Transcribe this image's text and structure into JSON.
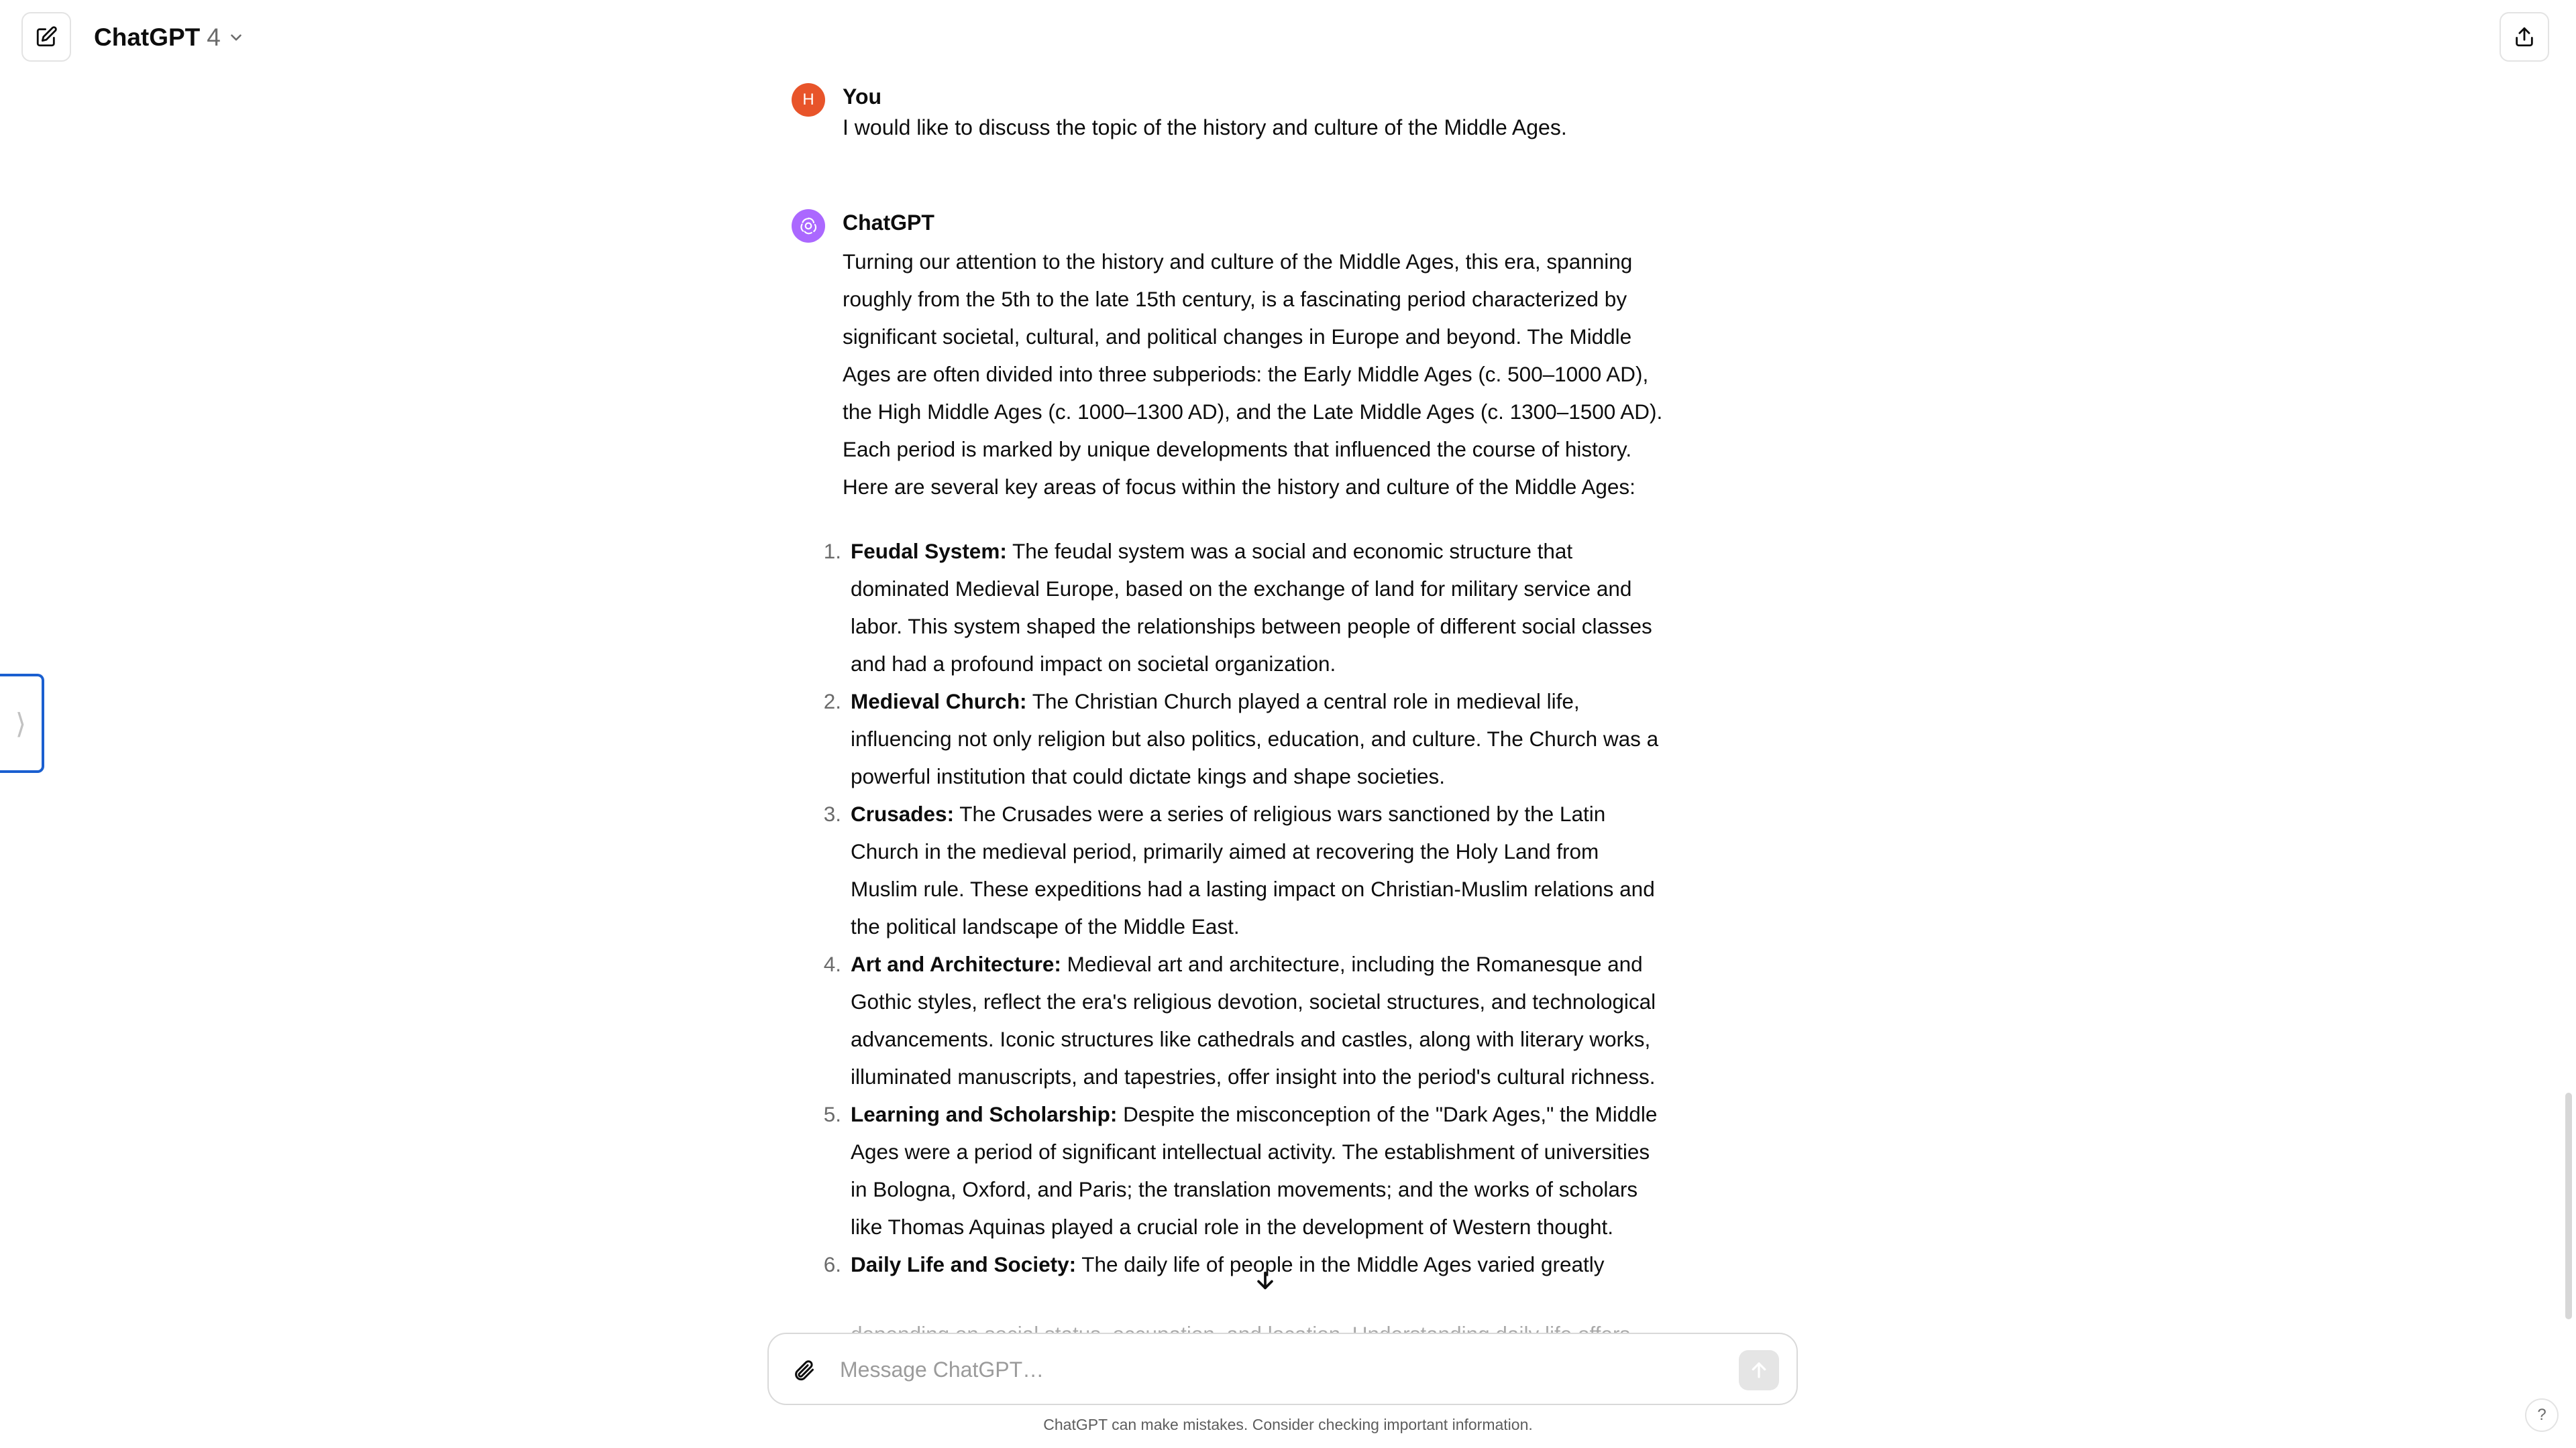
{
  "header": {
    "model_name": "ChatGPT",
    "model_version": "4"
  },
  "icons": {
    "new_chat": "edit-icon",
    "share": "share-icon",
    "chevron": "chevron-down-icon",
    "sidebar": "chevron-right-icon",
    "attach": "paperclip-icon",
    "send": "arrow-up-icon",
    "scroll": "arrow-down-icon",
    "help": "question-icon"
  },
  "sidebar_toggle": {
    "glyph": "⟩"
  },
  "conversation": {
    "user": {
      "avatar_initial": "H",
      "author": "You",
      "text": "I would like to discuss the topic of the history and culture of the Middle Ages."
    },
    "assistant": {
      "author": "ChatGPT",
      "intro": "Turning our attention to the history and culture of the Middle Ages, this era, spanning roughly from the 5th to the late 15th century, is a fascinating period characterized by significant societal, cultural, and political changes in Europe and beyond. The Middle Ages are often divided into three subperiods: the Early Middle Ages (c. 500–1000 AD), the High Middle Ages (c. 1000–1300 AD), and the Late Middle Ages (c. 1300–1500 AD). Each period is marked by unique developments that influenced the course of history. Here are several key areas of focus within the history and culture of the Middle Ages:",
      "points": [
        {
          "number": "1.",
          "term": "Feudal System:",
          "text": " The feudal system was a social and economic structure that dominated Medieval Europe, based on the exchange of land for military service and labor. This system shaped the relationships between people of different social classes and had a profound impact on societal organization."
        },
        {
          "number": "2.",
          "term": "Medieval Church:",
          "text": " The Christian Church played a central role in medieval life, influencing not only religion but also politics, education, and culture. The Church was a powerful institution that could dictate kings and shape societies."
        },
        {
          "number": "3.",
          "term": "Crusades:",
          "text": " The Crusades were a series of religious wars sanctioned by the Latin Church in the medieval period, primarily aimed at recovering the Holy Land from Muslim rule. These expeditions had a lasting impact on Christian-Muslim relations and the political landscape of the Middle East."
        },
        {
          "number": "4.",
          "term": "Art and Architecture:",
          "text": " Medieval art and architecture, including the Romanesque and Gothic styles, reflect the era's religious devotion, societal structures, and technological advancements. Iconic structures like cathedrals and castles, along with literary works, illuminated manuscripts, and tapestries, offer insight into the period's cultural richness."
        },
        {
          "number": "5.",
          "term": "Learning and Scholarship:",
          "text": " Despite the misconception of the \"Dark Ages,\" the Middle Ages were a period of significant intellectual activity. The establishment of universities in Bologna, Oxford, and Paris; the translation movements; and the works of scholars like Thomas Aquinas played a crucial role in the development of Western thought."
        },
        {
          "number": "6.",
          "term": "Daily Life and Society:",
          "text": " The daily life of people in the Middle Ages varied greatly"
        }
      ],
      "cut_off_line": "depending on social status, occupation, and location. Understanding daily life offers insight into"
    }
  },
  "composer": {
    "placeholder": "Message ChatGPT…",
    "value": ""
  },
  "footer": {
    "disclaimer": "ChatGPT can make mistakes. Consider checking important information.",
    "help_label": "?"
  },
  "colors": {
    "user_avatar": "#e8542a",
    "assistant_avatar": "#ab68ff",
    "sidebar_toggle_border": "#1a5fd0"
  }
}
